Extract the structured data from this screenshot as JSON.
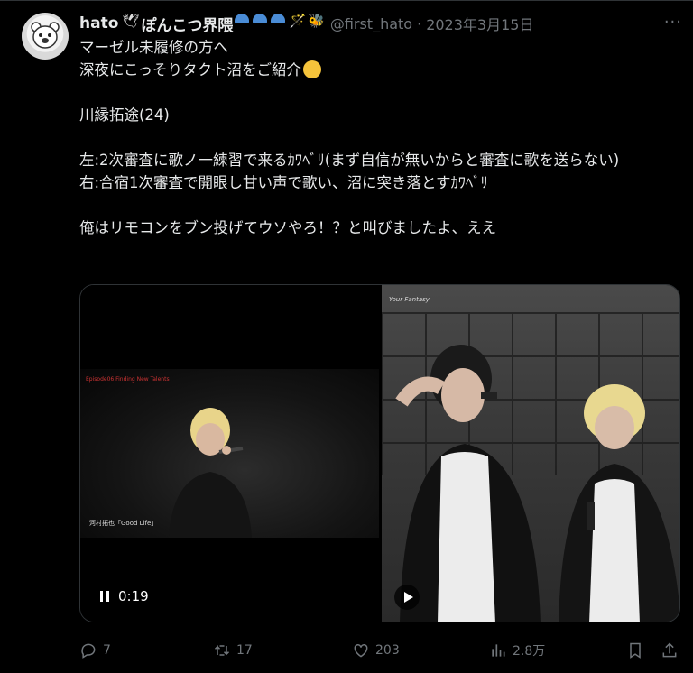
{
  "author": {
    "name": "hato",
    "badge_text": "ぽんこつ界隈",
    "handle": "@first_hato",
    "separator": "·",
    "date": "2023年3月15日",
    "more": "···"
  },
  "tweet": {
    "lines": [
      "マーゼル未履修の方へ",
      "深夜にこっそりタクト沼をご紹介",
      "",
      "川縁拓途(24)",
      "",
      "左:2次審査に歌ノ一練習で来るｶﾜﾍﾞﾘ(まず自信が無いからと審査に歌を送らない)",
      "右:合宿1次審査で開眼し甘い声で歌い、沼に突き落とすｶﾜﾍﾞﾘ",
      "",
      "俺はリモコンをブン投げてウソやろ！？と叫びましたよ、ええ"
    ]
  },
  "media": {
    "left_video": {
      "time": "0:19",
      "overlay_top": "Episode06 Finding New Talents",
      "overlay_caption": "河村拓也「Good Life」"
    },
    "right_video": {
      "overlay_tag": "Your Fantasy"
    }
  },
  "actions": {
    "replies": "7",
    "retweets": "17",
    "likes": "203",
    "views": "2.8万"
  },
  "colors": {
    "background": "#000000",
    "text": "#e7e9ea",
    "muted": "#71767b",
    "border": "#2f3336",
    "cap_blue": "#4a8cd6"
  }
}
